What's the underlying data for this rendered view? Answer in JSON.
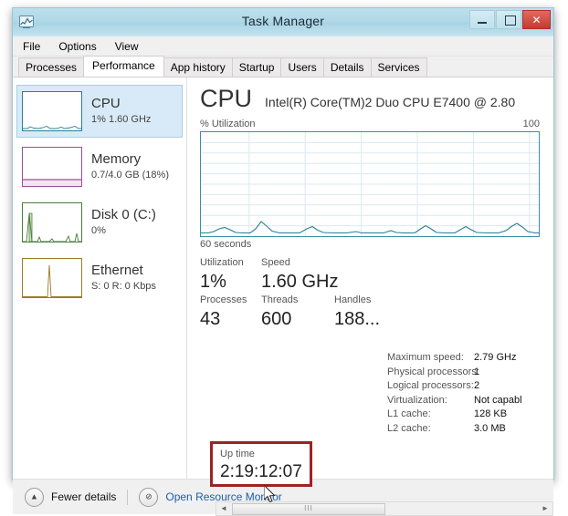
{
  "window": {
    "title": "Task Manager",
    "icon": "task-manager-icon",
    "border_color": "#9cc7d8",
    "titlebar_color": "#b2d9e8",
    "buttons": {
      "minimize": "minimize-icon",
      "maximize": "restore-icon",
      "close": "✕",
      "close_color": "#c33a31"
    }
  },
  "menu": {
    "items": [
      "File",
      "Options",
      "View"
    ]
  },
  "tabs": [
    {
      "label": "Processes",
      "active": false
    },
    {
      "label": "Performance",
      "active": true
    },
    {
      "label": "App history",
      "active": false
    },
    {
      "label": "Startup",
      "active": false
    },
    {
      "label": "Users",
      "active": false
    },
    {
      "label": "Details",
      "active": false
    },
    {
      "label": "Services",
      "active": false
    }
  ],
  "sidebar": {
    "items": [
      {
        "name": "CPU",
        "sub": "1%  1.60 GHz",
        "selected": true,
        "graph_color": "#2a7f96"
      },
      {
        "name": "Memory",
        "sub": "0.7/4.0 GB (18%)",
        "selected": false,
        "graph_color": "#9b4f96"
      },
      {
        "name": "Disk 0 (C:)",
        "sub": "0%",
        "selected": false,
        "graph_color": "#4a7f3a"
      },
      {
        "name": "Ethernet",
        "sub": "S: 0 R: 0 Kbps",
        "selected": false,
        "graph_color": "#9a7b28"
      }
    ]
  },
  "main": {
    "heading": "CPU",
    "model": "Intel(R) Core(TM)2 Duo CPU E7400 @ 2.80",
    "graph": {
      "y_label": "% Utilization",
      "y_max": "100",
      "x_label": "60 seconds",
      "line_color": "#2a7f96",
      "grid_color": "#d6e8ee"
    },
    "stats": [
      {
        "label": "Utilization",
        "value": "1%"
      },
      {
        "label": "Speed",
        "value": "1.60 GHz"
      },
      {
        "label": "Processes",
        "value": "43"
      },
      {
        "label": "Threads",
        "value": "600"
      },
      {
        "label": "Handles",
        "value": "188..."
      }
    ],
    "uptime": {
      "label": "Up time",
      "value": "2:19:12:07",
      "highlight_color": "#9c2323"
    },
    "specs": [
      {
        "key": "Maximum speed:",
        "value": "2.79 GHz"
      },
      {
        "key": "Physical processors:",
        "value": "1"
      },
      {
        "key": "Logical processors:",
        "value": "2"
      },
      {
        "key": "Virtualization:",
        "value": "Not capabl"
      },
      {
        "key": "L1 cache:",
        "value": "128 KB"
      },
      {
        "key": "L2 cache:",
        "value": "3.0 MB"
      }
    ],
    "scrollbar": {
      "left_arrow": "◄",
      "right_arrow": "►",
      "grip": "III"
    }
  },
  "footer": {
    "fewer_details": "Fewer details",
    "fewer_icon": "chevron-up-icon",
    "resource_monitor": "Open Resource Monitor",
    "resource_icon": "resource-monitor-icon",
    "link_color": "#1a5fa8"
  }
}
